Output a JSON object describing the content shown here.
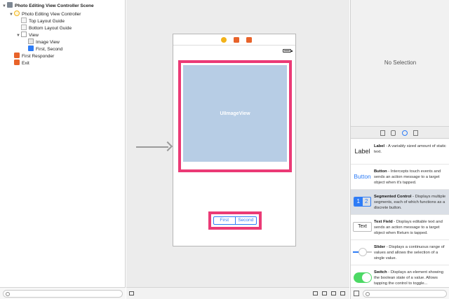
{
  "outline": {
    "items": [
      {
        "label": "Photo Editing View Controller Scene",
        "disclosure": "▼",
        "icon": "scene-icon"
      },
      {
        "label": "Photo Editing View Controller",
        "disclosure": "▼",
        "icon": "view-controller-icon"
      },
      {
        "label": "Top Layout Guide",
        "disclosure": "",
        "icon": "layout-guide-icon"
      },
      {
        "label": "Bottom Layout Guide",
        "disclosure": "",
        "icon": "layout-guide-icon"
      },
      {
        "label": "View",
        "disclosure": "▼",
        "icon": "view-icon"
      },
      {
        "label": "Image View",
        "disclosure": "",
        "icon": "image-view-icon"
      },
      {
        "label": "First, Second",
        "disclosure": "",
        "icon": "segmented-control-icon"
      },
      {
        "label": "First Responder",
        "disclosure": "",
        "icon": "first-responder-icon"
      },
      {
        "label": "Exit",
        "disclosure": "",
        "icon": "exit-icon"
      }
    ]
  },
  "canvas": {
    "image_view_label": "UIImageView",
    "segment_first": "First",
    "segment_second": "Second",
    "highlight_color": "#eb3a76"
  },
  "inspector": {
    "no_selection": "No Selection"
  },
  "library": {
    "items": [
      {
        "icon_text": "Label",
        "title": "Label",
        "desc": " - A variably sized amount of static text."
      },
      {
        "icon_text": "Button",
        "title": "Button",
        "desc": " - Intercepts touch events and sends an action message to a target object when it's tapped."
      },
      {
        "icon_text_1": "1",
        "icon_text_2": "2",
        "title": "Segmented Control",
        "desc": " - Displays multiple segments, each of which functions as a discrete button."
      },
      {
        "icon_text": "Text",
        "title": "Text Field",
        "desc": " - Displays editable text and sends an action message to a target object when Return is tapped."
      },
      {
        "title": "Slider",
        "desc": " - Displays a continuous range of values and allows the selection of a single value."
      },
      {
        "title": "Switch",
        "desc": " - Displays an element showing the boolean state of a value. Allows tapping the control to toggle..."
      }
    ]
  }
}
